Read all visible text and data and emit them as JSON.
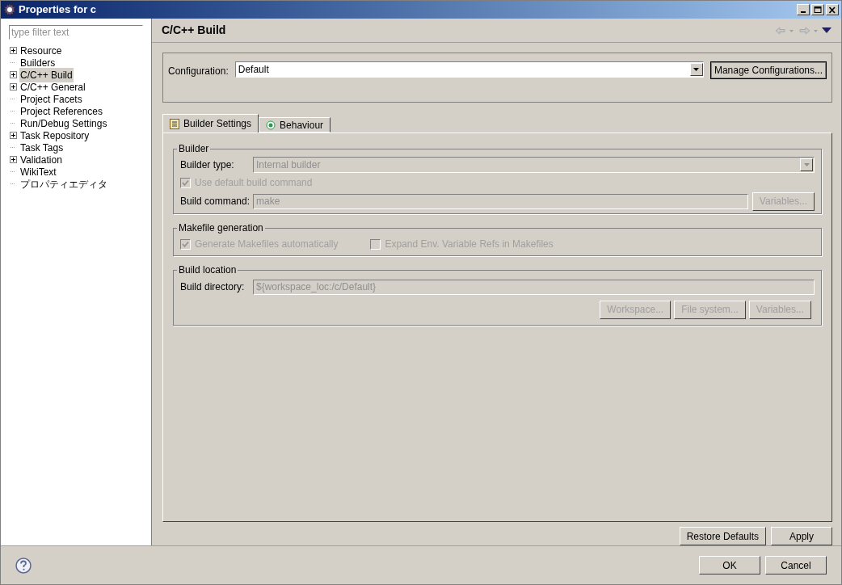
{
  "window": {
    "title": "Properties for c"
  },
  "sidebar": {
    "filter_placeholder": "type filter text",
    "items": [
      {
        "label": "Resource",
        "expandable": true,
        "selected": false
      },
      {
        "label": "Builders",
        "expandable": false,
        "selected": false
      },
      {
        "label": "C/C++ Build",
        "expandable": true,
        "selected": true
      },
      {
        "label": "C/C++ General",
        "expandable": true,
        "selected": false
      },
      {
        "label": "Project Facets",
        "expandable": false,
        "selected": false
      },
      {
        "label": "Project References",
        "expandable": false,
        "selected": false
      },
      {
        "label": "Run/Debug Settings",
        "expandable": false,
        "selected": false
      },
      {
        "label": "Task Repository",
        "expandable": true,
        "selected": false
      },
      {
        "label": "Task Tags",
        "expandable": false,
        "selected": false
      },
      {
        "label": "Validation",
        "expandable": true,
        "selected": false
      },
      {
        "label": "WikiText",
        "expandable": false,
        "selected": false
      },
      {
        "label": "プロパティエディタ",
        "expandable": false,
        "selected": false
      }
    ]
  },
  "page": {
    "title": "C/C++ Build"
  },
  "configuration": {
    "label": "Configuration:",
    "value": "Default",
    "button": "Manage Configurations..."
  },
  "tabs": [
    {
      "label": "Builder Settings",
      "kind": "list",
      "selected": true
    },
    {
      "label": "Behaviour",
      "kind": "radio",
      "selected": false
    }
  ],
  "groups": [
    {
      "title": "Builder",
      "rows": [
        {
          "kind": "combo",
          "label": "Builder type:",
          "value": "Internal builder",
          "disabled": true
        },
        {
          "kind": "checkbox",
          "label": "Use default build command",
          "checked": true,
          "disabled": true
        },
        {
          "kind": "text",
          "label": "Build command:",
          "value": "make",
          "disabled": true,
          "button": "Variables..."
        }
      ]
    },
    {
      "title": "Makefile generation",
      "rows": [
        {
          "kind": "checkpair",
          "items": [
            {
              "label": "Generate Makefiles automatically",
              "checked": true,
              "disabled": true
            },
            {
              "label": "Expand Env. Variable Refs in Makefiles",
              "checked": false,
              "disabled": true
            }
          ]
        }
      ]
    },
    {
      "title": "Build location",
      "rows": [
        {
          "kind": "text",
          "label": "Build directory:",
          "value": "${workspace_loc:/c/Default}",
          "disabled": true
        },
        {
          "kind": "buttons",
          "items": [
            {
              "label": "Workspace...",
              "disabled": true
            },
            {
              "label": "File system...",
              "disabled": true
            },
            {
              "label": "Variables...",
              "disabled": true
            }
          ]
        }
      ]
    }
  ],
  "page_buttons": [
    "Restore Defaults",
    "Apply"
  ],
  "dialog_buttons": [
    "OK",
    "Cancel"
  ]
}
